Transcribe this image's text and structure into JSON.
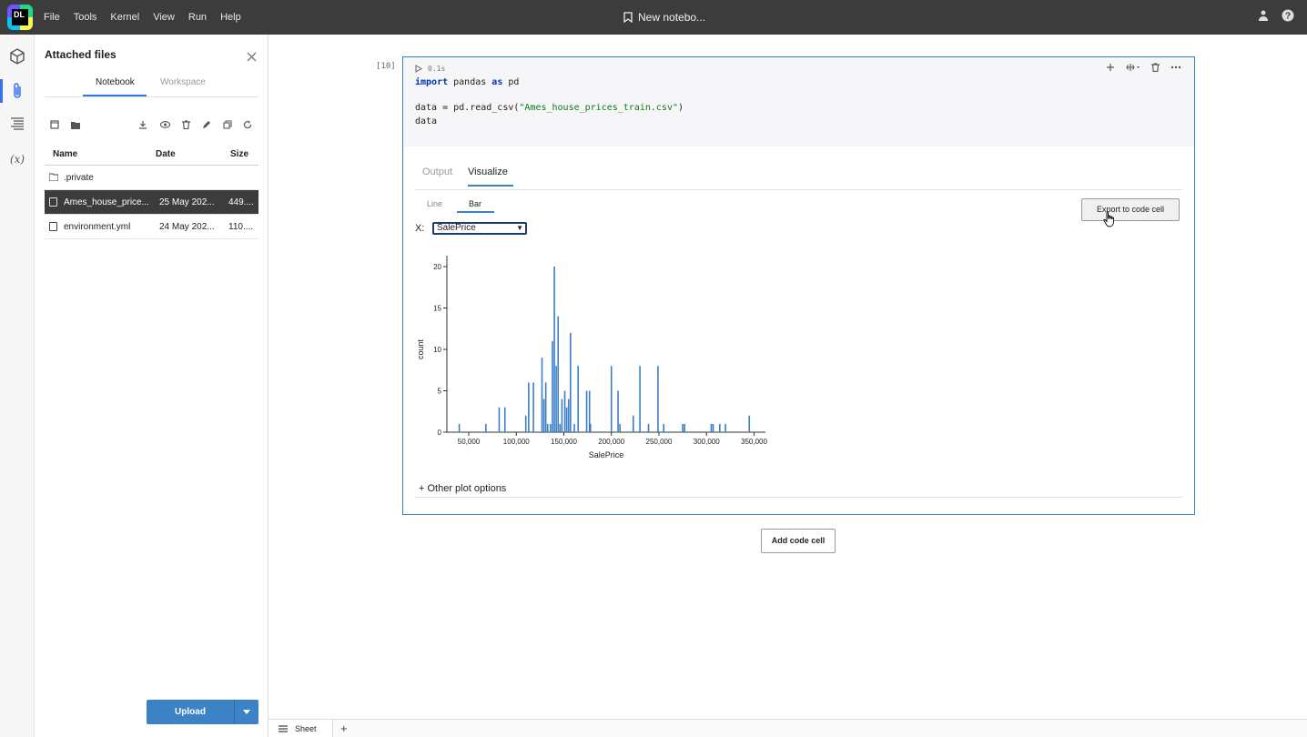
{
  "app": {
    "logo_text": "DL",
    "menu": [
      "File",
      "Tools",
      "Kernel",
      "View",
      "Run",
      "Help"
    ],
    "notebook_title": "New notebo..."
  },
  "rail": {
    "icons": [
      "package-icon",
      "paperclip-icon",
      "table-of-contents-icon",
      "variables-icon"
    ],
    "variables_label": "(x)"
  },
  "files_panel": {
    "title": "Attached files",
    "tabs": [
      "Notebook",
      "Workspace"
    ],
    "active_tab": "Notebook",
    "toolbar_icons": [
      "new-file-icon",
      "new-folder-icon",
      "download-icon",
      "preview-icon",
      "delete-icon",
      "rename-icon",
      "copy-icon",
      "refresh-icon"
    ],
    "columns": [
      "Name",
      "Date",
      "Size"
    ],
    "rows": [
      {
        "name": ".private",
        "date": "",
        "size": "",
        "kind": "folder"
      },
      {
        "name": "Ames_house_price...",
        "date": "25 May 202...",
        "size": "449....",
        "kind": "file",
        "selected": true
      },
      {
        "name": "environment.yml",
        "date": "24 May 202...",
        "size": "110....",
        "kind": "file"
      }
    ],
    "upload_label": "Upload"
  },
  "cell": {
    "exec_count": "[10]",
    "run_time": "0.1s",
    "code_lines": [
      {
        "kw": "import",
        "rest": " pandas ",
        "kw2": "as",
        "rest2": " pd"
      },
      {
        "plain": "data = pd.read_csv(",
        "str": "\"Ames_house_prices_train.csv\"",
        "end": ")"
      },
      {
        "plain": "data"
      }
    ],
    "output_tabs": [
      "Output",
      "Visualize"
    ],
    "active_output_tab": "Visualize",
    "plot_types": [
      "Line",
      "Bar"
    ],
    "active_plot_type": "Bar",
    "export_label": "Export to code cell",
    "x_label": "X:",
    "x_selected": "SalePrice",
    "other_options": "+ Other plot options"
  },
  "add_cell_label": "Add code cell",
  "sheet": {
    "tab_label": "Sheet",
    "add_label": "+"
  },
  "colors": {
    "accent": "#3c83c6",
    "bar": "#3a7fc4",
    "topbar": "#3c3c3c",
    "selected_row": "#3c3c3c"
  },
  "chart_data": {
    "type": "bar",
    "xlabel": "SalePrice",
    "ylabel": "count",
    "xlim": [
      27000,
      362000
    ],
    "ylim": [
      0,
      20
    ],
    "xticks": [
      50000,
      100000,
      150000,
      200000,
      250000,
      300000,
      350000
    ],
    "xtick_labels": [
      "50,000",
      "100,000",
      "150,000",
      "200,000",
      "250,000",
      "300,000",
      "350,000"
    ],
    "yticks": [
      0,
      5,
      10,
      15,
      20
    ],
    "points": [
      [
        40000,
        1
      ],
      [
        68000,
        1
      ],
      [
        82000,
        3
      ],
      [
        88000,
        3
      ],
      [
        110000,
        2
      ],
      [
        113000,
        6
      ],
      [
        118000,
        6
      ],
      [
        127000,
        9
      ],
      [
        129000,
        4
      ],
      [
        131000,
        6
      ],
      [
        133000,
        1
      ],
      [
        136000,
        1
      ],
      [
        138000,
        11
      ],
      [
        140000,
        20
      ],
      [
        142000,
        8
      ],
      [
        144000,
        14
      ],
      [
        146000,
        1
      ],
      [
        148000,
        4
      ],
      [
        151000,
        5
      ],
      [
        153000,
        3
      ],
      [
        155000,
        4
      ],
      [
        157000,
        12
      ],
      [
        161000,
        1
      ],
      [
        165000,
        8
      ],
      [
        174000,
        5
      ],
      [
        177000,
        5
      ],
      [
        178000,
        1
      ],
      [
        200000,
        8
      ],
      [
        207000,
        5
      ],
      [
        209000,
        1
      ],
      [
        223000,
        2
      ],
      [
        230000,
        8
      ],
      [
        239000,
        1
      ],
      [
        249000,
        8
      ],
      [
        255000,
        1
      ],
      [
        275000,
        1
      ],
      [
        277000,
        1
      ],
      [
        305000,
        1
      ],
      [
        307000,
        1
      ],
      [
        314000,
        1
      ],
      [
        320000,
        1
      ],
      [
        345000,
        2
      ]
    ]
  }
}
